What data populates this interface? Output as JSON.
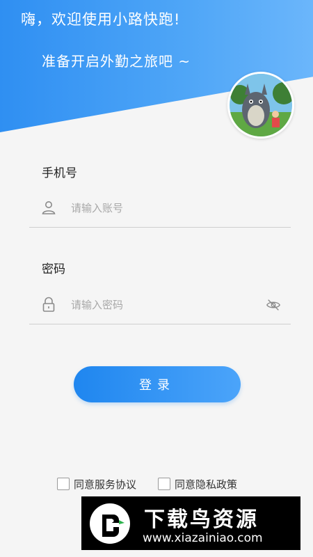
{
  "header": {
    "greeting": "嗨，欢迎使用小路快跑!",
    "subtitle": "准备开启外勤之旅吧 ~",
    "avatar_icon": "avatar-icon"
  },
  "phone": {
    "label": "手机号",
    "placeholder": "请输入账号",
    "value": ""
  },
  "password": {
    "label": "密码",
    "placeholder": "请输入密码",
    "value": ""
  },
  "login_label": "登录",
  "agreements": {
    "service": "同意服务协议",
    "privacy": "同意隐私政策"
  },
  "watermark": {
    "title": "下载鸟资源",
    "url": "www.xiazainiao.com"
  },
  "colors": {
    "accent": "#2f8ff2",
    "accent_light": "#4ba4fa"
  }
}
